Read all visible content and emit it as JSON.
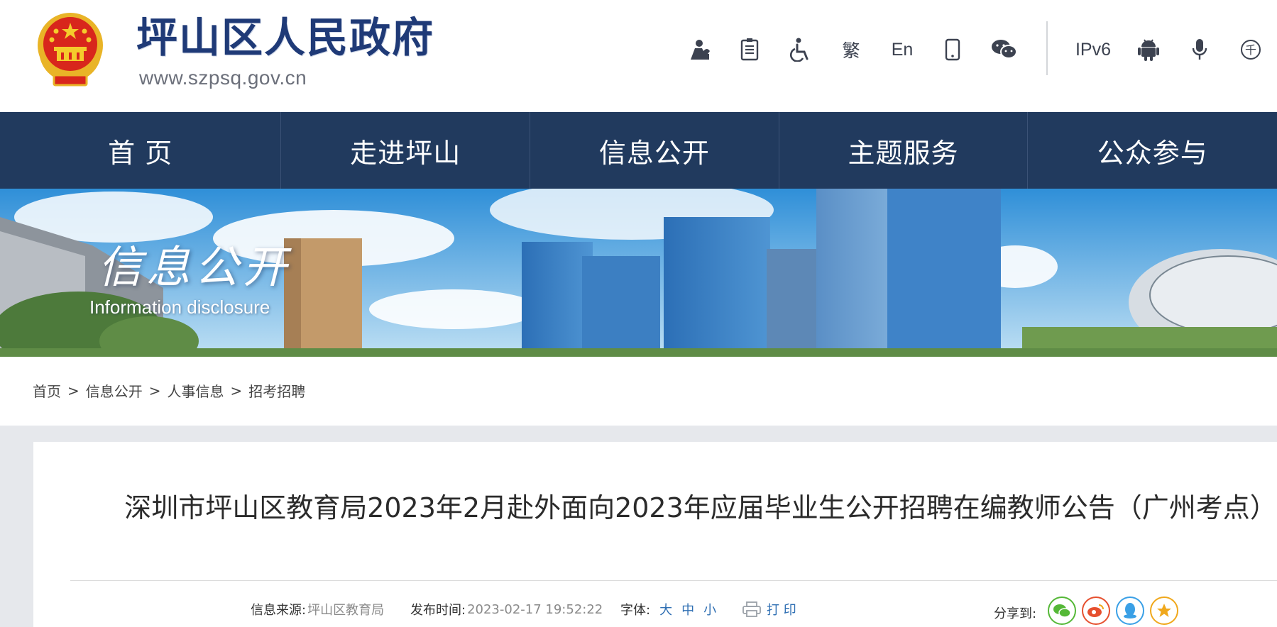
{
  "header": {
    "site_name": "坪山区人民政府",
    "site_url": "www.szpsq.gov.cn",
    "tools": [
      {
        "icon": "elderly-care-icon"
      },
      {
        "icon": "document-icon"
      },
      {
        "icon": "accessibility-icon"
      },
      {
        "label": "繁"
      },
      {
        "label": "En"
      },
      {
        "icon": "mobile-icon"
      },
      {
        "icon": "wechat-icon"
      },
      {
        "label": "IPv6"
      },
      {
        "icon": "android-icon"
      },
      {
        "icon": "microphone-icon"
      },
      {
        "label": "千"
      }
    ]
  },
  "nav": {
    "items": [
      "首 页",
      "走进坪山",
      "信息公开",
      "主题服务",
      "公众参与"
    ]
  },
  "banner": {
    "title": "信息公开",
    "subtitle": "Information disclosure"
  },
  "breadcrumb": {
    "items": [
      "首页",
      "信息公开",
      "人事信息",
      "招考招聘"
    ],
    "separator": ">"
  },
  "article": {
    "title": "深圳市坪山区教育局2023年2月赴外面向2023年应届毕业生公开招聘在编教师公告（广州考点）",
    "source_label": "信息来源:",
    "source_value": "坪山区教育局",
    "time_label": "发布时间:",
    "time_value": "2023-02-17 19:52:22",
    "font_label": "字体:",
    "font_sizes": [
      "大",
      "中",
      "小"
    ],
    "print_label": "打 印",
    "share_label": "分享到:",
    "share_targets": [
      {
        "icon": "wechat-share-icon",
        "color": "#55b837"
      },
      {
        "icon": "weibo-share-icon",
        "color": "#e6502f"
      },
      {
        "icon": "qq-share-icon",
        "color": "#3aa0e6"
      },
      {
        "icon": "qzone-share-icon",
        "color": "#f0a81c"
      }
    ]
  },
  "colors": {
    "nav_bg": "#213a5e",
    "brand_blue": "#1f3a77",
    "link_blue": "#2f6fb3",
    "content_bg": "#e6e8ec"
  }
}
